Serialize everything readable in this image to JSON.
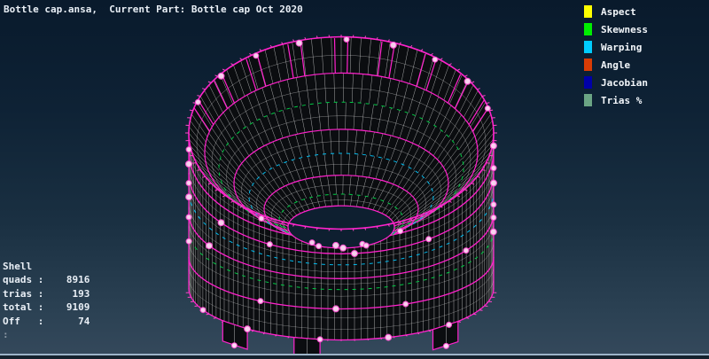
{
  "header": {
    "title": "Bottle cap.ansa,  Current Part: Bottle cap Oct 2020"
  },
  "legend": {
    "items": [
      {
        "label": "Aspect",
        "color": "#ffff00"
      },
      {
        "label": "Skewness",
        "color": "#00ee00"
      },
      {
        "label": "Warping",
        "color": "#00ccff"
      },
      {
        "label": "Angle",
        "color": "#d93c05"
      },
      {
        "label": "Jacobian",
        "color": "#0000a8"
      },
      {
        "label": "Trias %",
        "color": "#6ba584"
      }
    ]
  },
  "stats": {
    "title": "Shell",
    "rows": [
      {
        "label": "quads :",
        "value": "8916"
      },
      {
        "label": "trias :",
        "value": "193"
      },
      {
        "label": "total :",
        "value": "9109"
      },
      {
        "label": "Off   :",
        "value": "74"
      }
    ],
    "prompt": ":"
  },
  "colors": {
    "background_top": "#091a2c",
    "background_bottom": "#35495c",
    "face": "#0b0d10",
    "hole": "#0e1f30",
    "mesh_line": "#e2e2e2",
    "feature_edge": "#ff22cc",
    "tick": "#ff44cc",
    "dash_green": "#00cc44",
    "dash_cyan": "#00bbee",
    "dot_fill": "#ffd9f5",
    "dot_stroke": "#ff4dd2"
  }
}
